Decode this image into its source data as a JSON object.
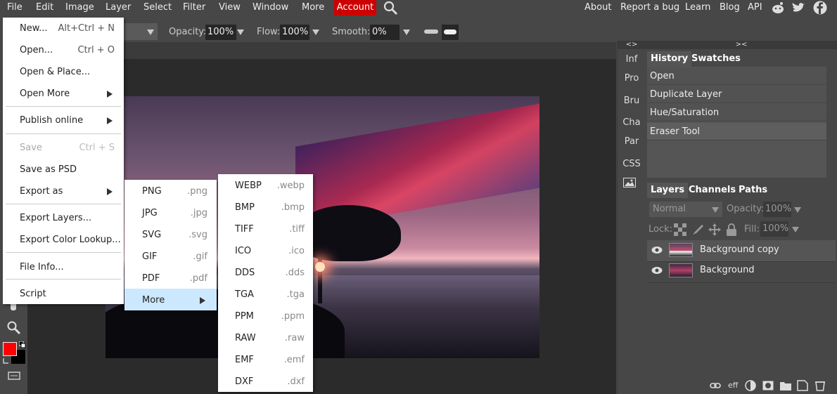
{
  "menubar": {
    "items": [
      "File",
      "Edit",
      "Image",
      "Layer",
      "Select",
      "Filter",
      "View",
      "Window",
      "More",
      "Account"
    ],
    "right": [
      "About",
      "Report a bug",
      "Learn",
      "Blog",
      "API"
    ]
  },
  "toolbar": {
    "opacity_label": "Opacity:",
    "opacity": "100%",
    "flow_label": "Flow:",
    "flow": "100%",
    "smooth_label": "Smooth:",
    "smooth": "0%"
  },
  "right_narrow": {
    "items": [
      "Inf",
      "Pro",
      "Bru",
      "Cha",
      "Par",
      "CSS"
    ],
    "collapse_left": "<>",
    "collapse_right": "><"
  },
  "history": {
    "tabs": [
      "History",
      "Swatches"
    ],
    "items": [
      "Open",
      "Duplicate Layer",
      "Hue/Saturation",
      "Eraser Tool"
    ]
  },
  "layers": {
    "tabs": [
      "Layers",
      "Channels",
      "Paths"
    ],
    "blend": "Normal",
    "opacity_label": "Opacity:",
    "opacity": "100%",
    "lock_label": "Lock:",
    "fill_label": "Fill:",
    "fill": "100%",
    "items": [
      "Background copy",
      "Background"
    ],
    "footer_eff": "eff"
  },
  "file_menu": {
    "items": [
      {
        "label": "New...",
        "shortcut": "Alt+Ctrl + N"
      },
      {
        "label": "Open...",
        "shortcut": "Ctrl + O"
      },
      {
        "label": "Open & Place...",
        "shortcut": ""
      },
      {
        "label": "Open More",
        "shortcut": ""
      },
      {
        "label": "Publish online",
        "shortcut": ""
      },
      {
        "label": "Save",
        "shortcut": "Ctrl + S"
      },
      {
        "label": "Save as PSD",
        "shortcut": ""
      },
      {
        "label": "Export as",
        "shortcut": ""
      },
      {
        "label": "Export Layers...",
        "shortcut": ""
      },
      {
        "label": "Export Color Lookup...",
        "shortcut": ""
      },
      {
        "label": "File Info...",
        "shortcut": ""
      },
      {
        "label": "Script",
        "shortcut": ""
      }
    ]
  },
  "export_menu": {
    "items": [
      {
        "label": "PNG",
        "ext": ".png"
      },
      {
        "label": "JPG",
        "ext": ".jpg"
      },
      {
        "label": "SVG",
        "ext": ".svg"
      },
      {
        "label": "GIF",
        "ext": ".gif"
      },
      {
        "label": "PDF",
        "ext": ".pdf"
      },
      {
        "label": "More",
        "ext": ""
      }
    ]
  },
  "more_menu": {
    "items": [
      {
        "label": "WEBP",
        "ext": ".webp"
      },
      {
        "label": "BMP",
        "ext": ".bmp"
      },
      {
        "label": "TIFF",
        "ext": ".tiff"
      },
      {
        "label": "ICO",
        "ext": ".ico"
      },
      {
        "label": "DDS",
        "ext": ".dds"
      },
      {
        "label": "TGA",
        "ext": ".tga"
      },
      {
        "label": "PPM",
        "ext": ".ppm"
      },
      {
        "label": "RAW",
        "ext": ".raw"
      },
      {
        "label": "EMF",
        "ext": ".emf"
      },
      {
        "label": "DXF",
        "ext": ".dxf"
      }
    ]
  },
  "colors": {
    "accent": "#cc0000",
    "foreground": "#ff0000",
    "background": "#000000",
    "highlight": "#cce8ff"
  }
}
